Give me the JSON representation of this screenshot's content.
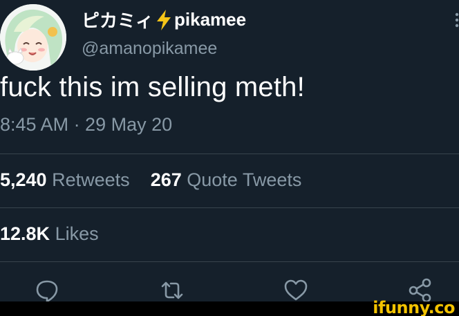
{
  "tweet": {
    "display_name_prefix": "ピカミィ",
    "display_name_suffix": "pikamee",
    "handle": "@amanopikamee",
    "text": "fuck this im selling meth!",
    "timestamp": "8:45 AM · 29 May 20"
  },
  "stats": {
    "retweets_count": "5,240",
    "retweets_label": "Retweets",
    "quote_count": "267",
    "quote_label": "Quote Tweets",
    "likes_count": "12.8K",
    "likes_label": "Likes"
  },
  "actions": {
    "reply_icon": "reply-icon",
    "retweet_icon": "retweet-icon",
    "like_icon": "heart-icon",
    "share_icon": "share-icon"
  },
  "watermark": {
    "text": "ifunny.co"
  },
  "colors": {
    "background": "#15202b",
    "primary_text": "#ffffff",
    "secondary_text": "#8899a6",
    "divider": "#38444d",
    "lightning": "#f5c518",
    "watermark": "#f2c200"
  }
}
